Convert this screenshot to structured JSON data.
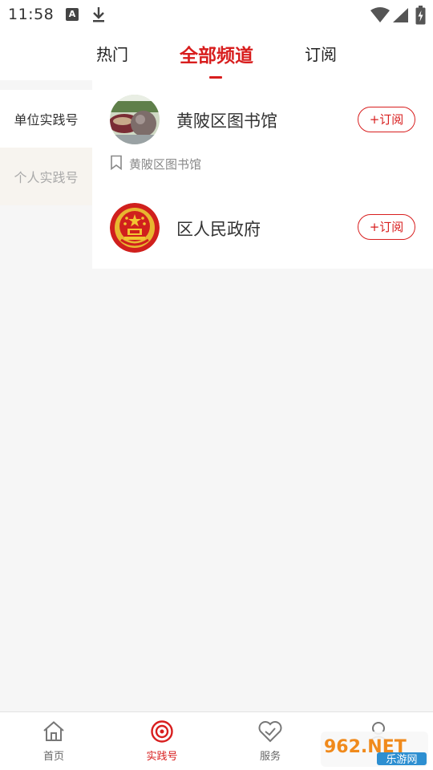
{
  "status_bar": {
    "time": "11:58",
    "a_badge": "A",
    "icons": [
      "a-badge-icon",
      "download-icon",
      "wifi-icon",
      "signal-icon",
      "battery-charging-icon"
    ]
  },
  "tabs": [
    {
      "label": "热门",
      "active": false
    },
    {
      "label": "全部频道",
      "active": true
    },
    {
      "label": "订阅",
      "active": false
    }
  ],
  "categories": [
    {
      "label": "单位实践号",
      "active": true
    },
    {
      "label": "个人实践号",
      "active": false
    }
  ],
  "channels": [
    {
      "name": "黄陂区图书馆",
      "subscribe_label": "+订阅",
      "description": "黄陂区图书馆",
      "avatar": "library-photo"
    },
    {
      "name": "区人民政府",
      "subscribe_label": "+订阅",
      "avatar": "national-emblem"
    }
  ],
  "bottom_nav": [
    {
      "label": "首页",
      "icon": "home-icon",
      "active": false
    },
    {
      "label": "实践号",
      "icon": "target-icon",
      "active": true
    },
    {
      "label": "服务",
      "icon": "heart-check-icon",
      "active": false
    },
    {
      "label": "",
      "icon": "user-icon",
      "active": false
    }
  ],
  "watermark": {
    "text": "962.NET",
    "subtext": "乐游网"
  },
  "colors": {
    "accent": "#d81e1e",
    "background": "#f6f6f6",
    "sidebar_inactive": "#f7f4ef"
  }
}
